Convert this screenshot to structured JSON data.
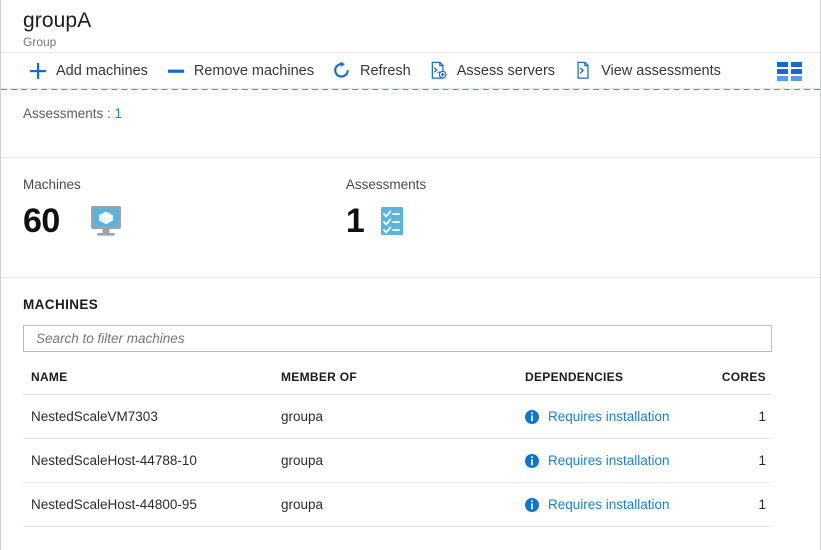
{
  "header": {
    "title": "groupA",
    "subtitle": "Group"
  },
  "toolbar": {
    "items": [
      {
        "label": "Add machines",
        "icon": "plus-icon"
      },
      {
        "label": "Remove machines",
        "icon": "minus-icon"
      },
      {
        "label": "Refresh",
        "icon": "refresh-icon"
      },
      {
        "label": "Assess servers",
        "icon": "assess-servers-icon"
      },
      {
        "label": "View assessments",
        "icon": "view-assessments-icon"
      }
    ],
    "grid_view_icon": "grid-view-icon"
  },
  "filter": {
    "label": "Assessments :",
    "value": "1"
  },
  "stats": [
    {
      "label": "Machines",
      "value": "60",
      "icon": "machine-monitor-icon"
    },
    {
      "label": "Assessments",
      "value": "1",
      "icon": "assessment-checklist-icon"
    }
  ],
  "machines_section": {
    "title": "MACHINES",
    "search_placeholder": "Search to filter machines",
    "search_value": "",
    "columns": [
      "NAME",
      "MEMBER OF",
      "DEPENDENCIES",
      "CORES"
    ],
    "rows": [
      {
        "name": "NestedScaleVM7303",
        "member_of": "groupa",
        "dependencies": "Requires installation",
        "cores": "1"
      },
      {
        "name": "NestedScaleHost-44788-10",
        "member_of": "groupa",
        "dependencies": "Requires installation",
        "cores": "1"
      },
      {
        "name": "NestedScaleHost-44800-95",
        "member_of": "groupa",
        "dependencies": "Requires installation",
        "cores": "1"
      }
    ]
  },
  "colors": {
    "accent_blue": "#1668d6",
    "link_blue": "#1a7fd4",
    "dash_cyan": "#16a8e8",
    "icon_light_blue": "#59b4e0"
  }
}
